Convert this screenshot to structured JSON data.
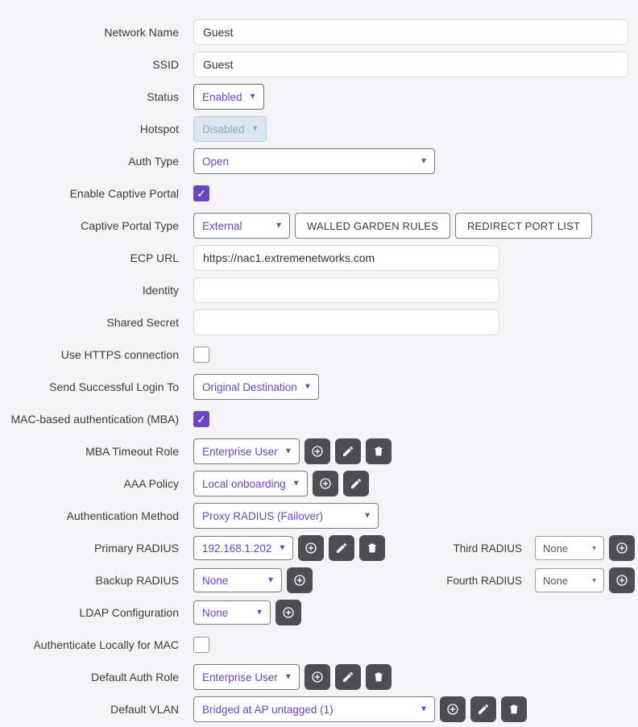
{
  "labels": {
    "network_name": "Network Name",
    "ssid": "SSID",
    "status": "Status",
    "hotspot": "Hotspot",
    "auth_type": "Auth Type",
    "enable_captive_portal": "Enable Captive Portal",
    "captive_portal_type": "Captive Portal Type",
    "ecp_url": "ECP URL",
    "identity": "Identity",
    "shared_secret": "Shared Secret",
    "use_https": "Use HTTPS connection",
    "send_login_to": "Send Successful Login To",
    "mba": "MAC-based authentication (MBA)",
    "mba_timeout_role": "MBA Timeout Role",
    "aaa_policy": "AAA Policy",
    "auth_method": "Authentication Method",
    "primary_radius": "Primary RADIUS",
    "backup_radius": "Backup RADIUS",
    "ldap_config": "LDAP Configuration",
    "third_radius": "Third RADIUS",
    "fourth_radius": "Fourth RADIUS",
    "auth_locally_mac": "Authenticate Locally for MAC",
    "default_auth_role": "Default Auth Role",
    "default_vlan": "Default VLAN"
  },
  "values": {
    "network_name": "Guest",
    "ssid": "Guest",
    "status": "Enabled",
    "hotspot": "Disabled",
    "auth_type": "Open",
    "captive_portal_type": "External",
    "ecp_url": "https://nac1.extremenetworks.com",
    "identity": "",
    "shared_secret": "",
    "send_login_to": "Original Destination",
    "mba_timeout_role": "Enterprise User",
    "aaa_policy": "Local onboarding",
    "auth_method": "Proxy RADIUS (Failover)",
    "primary_radius": "192.168.1.202",
    "backup_radius": "None",
    "third_radius": "None",
    "fourth_radius": "None",
    "ldap_config": "None",
    "default_auth_role": "Enterprise User",
    "default_vlan": "Bridged at AP untagged (1)"
  },
  "checkboxes": {
    "enable_captive_portal": true,
    "use_https": false,
    "mba": true,
    "auth_locally_mac": false
  },
  "buttons": {
    "walled_garden": "WALLED GARDEN RULES",
    "redirect_port": "REDIRECT PORT LIST"
  }
}
